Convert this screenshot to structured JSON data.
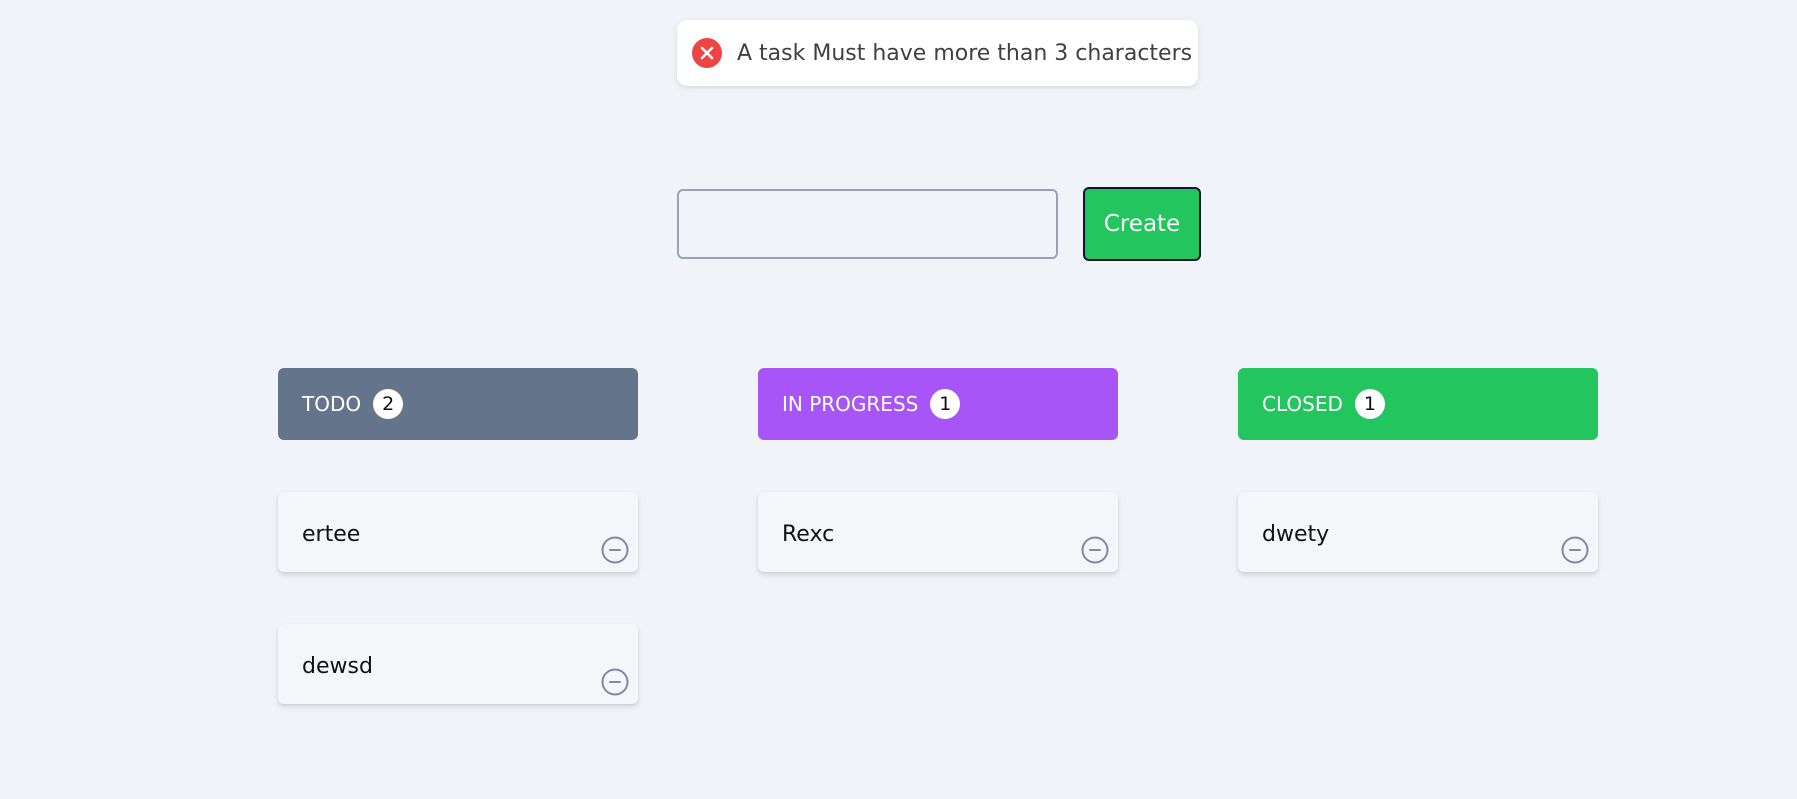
{
  "toast": {
    "message": "A task Must have more than 3 characters",
    "icon": "error-x-icon",
    "color": "#ef4444"
  },
  "form": {
    "input_value": "",
    "input_placeholder": "",
    "create_label": "Create",
    "create_color": "#22c55e"
  },
  "columns": [
    {
      "title": "TODO",
      "count": "2",
      "color": "#64748b",
      "tasks": [
        "ertee",
        "dewsd"
      ]
    },
    {
      "title": "IN PROGRESS",
      "count": "1",
      "color": "#a855f7",
      "tasks": [
        "Rexc"
      ]
    },
    {
      "title": "CLOSED",
      "count": "1",
      "color": "#22c55e",
      "tasks": [
        "dwety"
      ]
    }
  ]
}
